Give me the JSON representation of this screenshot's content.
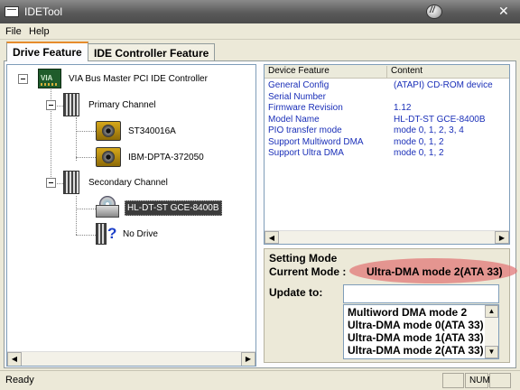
{
  "window": {
    "title": "IDETool"
  },
  "menu": [
    {
      "label": "File"
    },
    {
      "label": "Help"
    }
  ],
  "tabs": [
    {
      "label": "Drive Feature",
      "active": true
    },
    {
      "label": "IDE Controller Feature",
      "active": false
    }
  ],
  "tree": {
    "controller": {
      "label": "VIA Bus Master PCI IDE Controller",
      "icon": "controller-board-icon"
    },
    "primary": {
      "label": "Primary Channel",
      "icon": "ide-channel-icon",
      "devices": [
        {
          "label": "ST340016A",
          "icon": "hard-disk-icon"
        },
        {
          "label": "IBM-DPTA-372050",
          "icon": "hard-disk-icon"
        }
      ]
    },
    "secondary": {
      "label": "Secondary Channel",
      "icon": "ide-channel-icon",
      "devices": [
        {
          "label": "HL-DT-ST GCE-8400B",
          "icon": "cd-rom-icon",
          "selected": true
        },
        {
          "label": "No Drive",
          "icon": "no-drive-icon"
        }
      ]
    }
  },
  "details": {
    "headers": {
      "feature": "Device Feature",
      "content": "Content"
    },
    "rows": [
      {
        "feature": "General Config",
        "content": "(ATAPI) CD-ROM device"
      },
      {
        "feature": "Serial Number",
        "content": ""
      },
      {
        "feature": "Firmware Revision",
        "content": "1.12"
      },
      {
        "feature": "Model Name",
        "content": "HL-DT-ST GCE-8400B"
      },
      {
        "feature": "PIO transfer mode",
        "content": "mode 0, 1, 2, 3, 4"
      },
      {
        "feature": "Support Multiword DMA",
        "content": "mode 0, 1, 2"
      },
      {
        "feature": "Support Ultra DMA",
        "content": "mode 0, 1, 2"
      }
    ]
  },
  "setting": {
    "legend": "Setting Mode",
    "current_label": "Current Mode :",
    "current_value": "Ultra-DMA mode 2(ATA 33)",
    "update_label": "Update to:",
    "update_value": "",
    "options": [
      "Multiword DMA mode 2",
      "Ultra-DMA mode 0(ATA 33)",
      "Ultra-DMA mode 1(ATA 33)",
      "Ultra-DMA mode 2(ATA 33)"
    ]
  },
  "status": {
    "text": "Ready",
    "panes": [
      "",
      "NUM",
      ""
    ]
  }
}
